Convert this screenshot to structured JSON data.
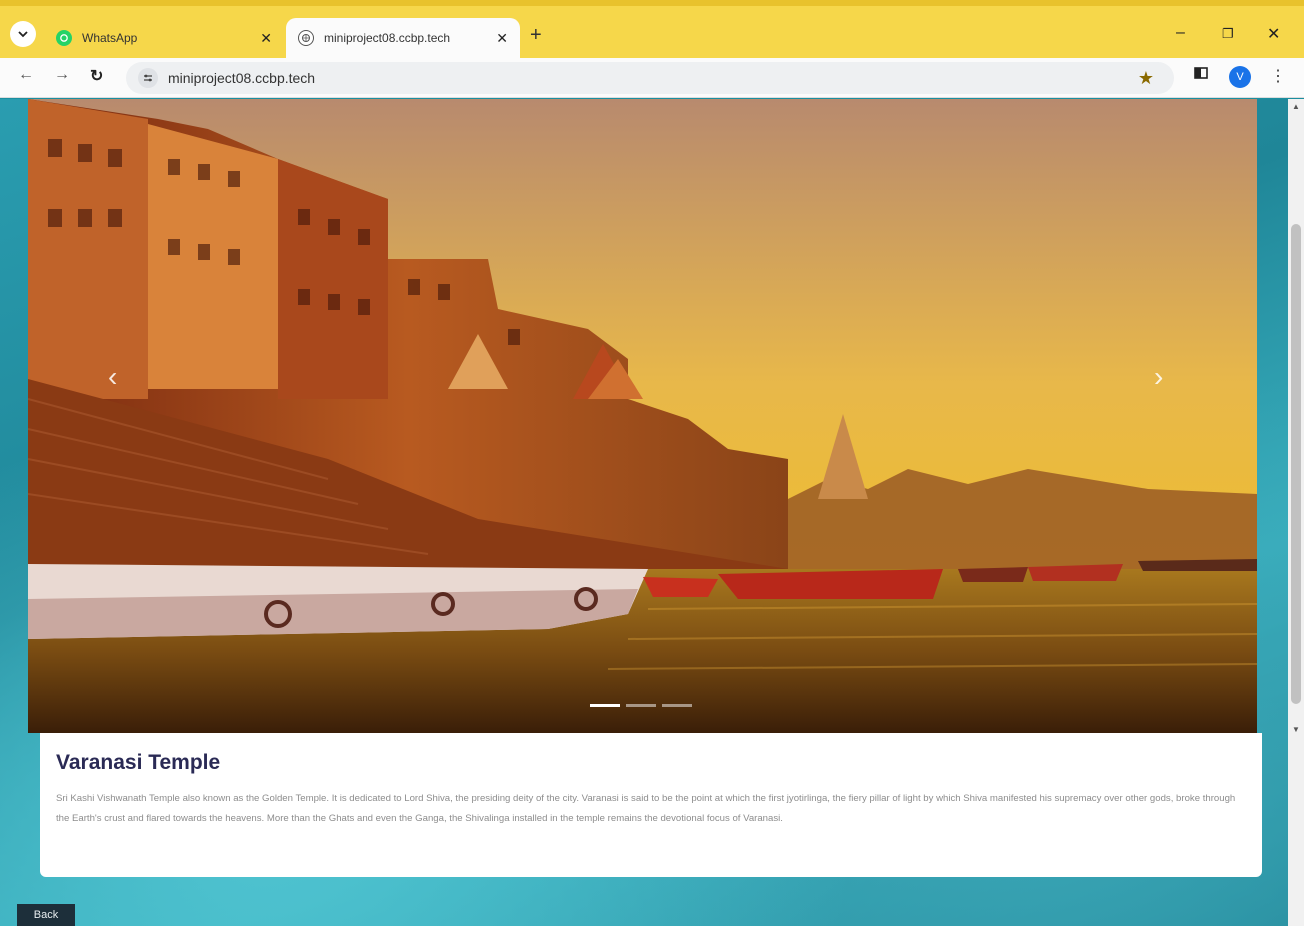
{
  "browser": {
    "tabs": [
      {
        "label": "WhatsApp",
        "active": false,
        "favicon": "whatsapp-icon"
      },
      {
        "label": "miniproject08.ccbp.tech",
        "active": true,
        "favicon": "globe-icon"
      }
    ],
    "new_tab": "+",
    "url": "miniproject08.ccbp.tech",
    "profile_initial": "V",
    "controls": {
      "minimize": "–",
      "restore": "❐",
      "close": "✕"
    }
  },
  "carousel": {
    "prev": "‹",
    "next": "›",
    "indicator_count": 3,
    "active_index": 0
  },
  "card": {
    "title": "Varanasi Temple",
    "description": "Sri Kashi Vishwanath Temple also known as the Golden Temple. It is dedicated to Lord Shiva, the presiding deity of the city. Varanasi is said to be the point at which the first jyotirlinga, the fiery pillar of light by which Shiva manifested his supremacy over other gods, broke through the Earth's crust and flared towards the heavens. More than the Ghats and even the Ganga, the Shivalinga installed in the temple remains the devotional focus of Varanasi."
  },
  "back_label": "Back",
  "colors": {
    "accent": "#f6d74a",
    "title": "#2a2a55",
    "page_bg": "#1f8698"
  }
}
